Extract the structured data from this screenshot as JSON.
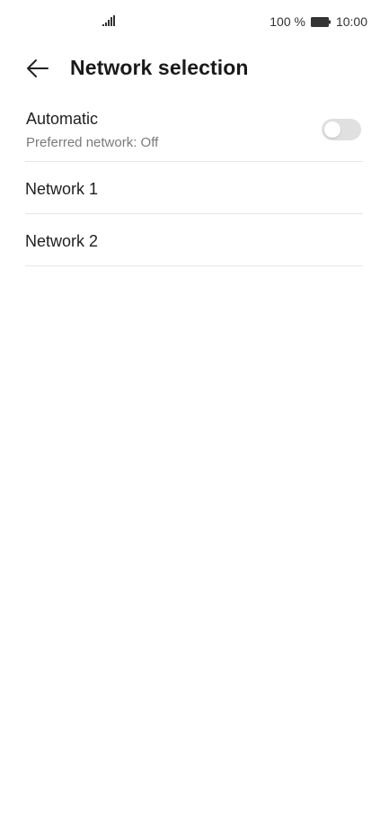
{
  "status_bar": {
    "signal_icon": "signal-bars-icon",
    "battery_text": "100 %",
    "battery_icon": "battery-full-icon",
    "time": "10:00"
  },
  "header": {
    "back_icon": "arrow-left-icon",
    "title": "Network selection"
  },
  "automatic": {
    "title": "Automatic",
    "subtitle": "Preferred network: Off",
    "toggle_on": false
  },
  "networks": [
    {
      "label": "Network 1"
    },
    {
      "label": "Network 2"
    }
  ],
  "colors": {
    "toggle_off": "#e0e0e0",
    "divider": "#e6e6e6",
    "subtitle": "#7a7a7a"
  }
}
